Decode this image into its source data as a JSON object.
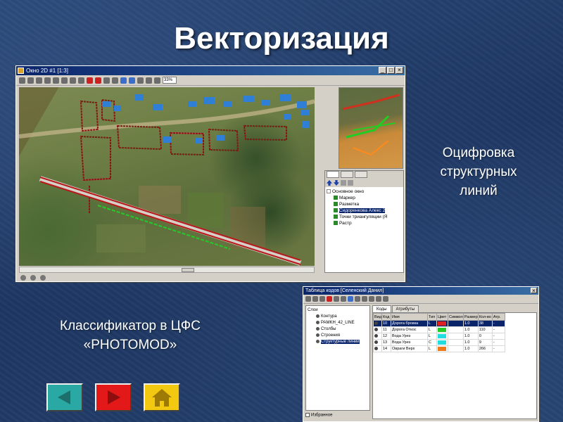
{
  "slide": {
    "title": "Векторизация",
    "caption_right": "Оцифровка структурных линий",
    "caption_left": "Классификатор в ЦФС «PHOTOMOD»"
  },
  "main_window": {
    "title": "Окно 2D #1 [1:3]",
    "zoom_value": "33%",
    "layer_tree": [
      {
        "label": "Основное окно",
        "level": 0
      },
      {
        "label": "Маркер",
        "level": 1
      },
      {
        "label": "Разметка",
        "level": 1
      },
      {
        "label": "Сидоренкова Алекс 2",
        "level": 1,
        "selected": true
      },
      {
        "label": "Точки триангуляции (Я",
        "level": 1
      },
      {
        "label": "Растр",
        "level": 1
      }
    ]
  },
  "code_window": {
    "title": "Таблица кодов [Селенский Данил]",
    "tabs": [
      "Коды",
      "Атрибуты"
    ],
    "tree": [
      {
        "label": "Слои",
        "level": 0
      },
      {
        "label": "Контура",
        "level": 1
      },
      {
        "label": "PAMKH_42_LINE",
        "level": 1
      },
      {
        "label": "Столбы",
        "level": 1
      },
      {
        "label": "Строения",
        "level": 1
      },
      {
        "label": "Структурные линии",
        "level": 1,
        "selected": true
      }
    ],
    "favorites_label": "Избранное",
    "columns": [
      "Вид",
      "Код",
      "Имя",
      "Тип",
      "Цвет",
      "Символ",
      "Размер",
      "Кол-во",
      "Атр."
    ],
    "rows": [
      {
        "code": "10",
        "name": "Дорога бровка",
        "type": "L",
        "color": "#e02020",
        "size": "1.0",
        "count": "38",
        "attr": "-",
        "selected": true
      },
      {
        "code": "11",
        "name": "Дорога Откос",
        "type": "L",
        "color": "#22cc22",
        "size": "1.0",
        "count": "110",
        "attr": "-"
      },
      {
        "code": "12",
        "name": "Вода Урез",
        "type": "L",
        "color": "#22dddd",
        "size": "1.0",
        "count": "0",
        "attr": "-"
      },
      {
        "code": "13",
        "name": "Вода Урез",
        "type": "C",
        "color": "#22dddd",
        "size": "1.0",
        "count": "9",
        "attr": "-"
      },
      {
        "code": "14",
        "name": "Овраги Верх",
        "type": "L",
        "color": "#ee7a1a",
        "size": "1.0",
        "count": "266",
        "attr": "-"
      }
    ]
  },
  "colors": {
    "prev_button": "#2aa9a4",
    "next_button": "#e31818",
    "home_button": "#f2c810"
  },
  "icons": {
    "prev": "triangle-left-icon",
    "next": "triangle-right-icon",
    "home": "house-icon"
  }
}
